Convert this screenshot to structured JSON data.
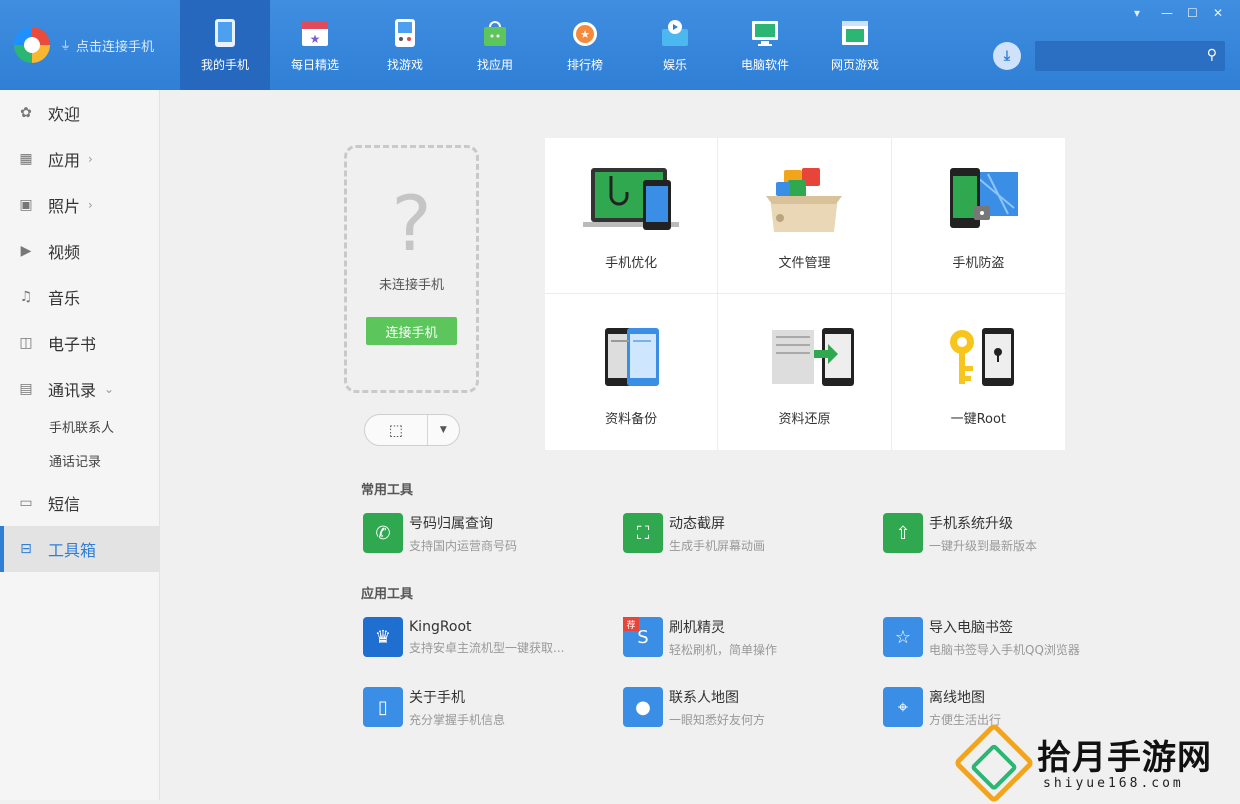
{
  "header": {
    "connect_label": "点击连接手机",
    "tabs": [
      {
        "label": "我的手机",
        "icon": "phone-icon"
      },
      {
        "label": "每日精选",
        "icon": "calendar-star-icon"
      },
      {
        "label": "找游戏",
        "icon": "gamepad-icon"
      },
      {
        "label": "找应用",
        "icon": "android-bag-icon"
      },
      {
        "label": "排行榜",
        "icon": "medal-icon"
      },
      {
        "label": "娱乐",
        "icon": "media-icon"
      },
      {
        "label": "电脑软件",
        "icon": "pc-icon"
      },
      {
        "label": "网页游戏",
        "icon": "web-game-icon"
      }
    ],
    "search_placeholder": ""
  },
  "sidebar": {
    "items": [
      {
        "label": "欢迎"
      },
      {
        "label": "应用"
      },
      {
        "label": "照片"
      },
      {
        "label": "视频"
      },
      {
        "label": "音乐"
      },
      {
        "label": "电子书"
      },
      {
        "label": "通讯录"
      },
      {
        "label": "短信"
      },
      {
        "label": "工具箱"
      }
    ],
    "contacts_sub": [
      "手机联系人",
      "通话记录"
    ]
  },
  "phone": {
    "placeholder_symbol": "?",
    "status": "未连接手机",
    "connect_button": "连接手机"
  },
  "features": [
    {
      "label": "手机优化"
    },
    {
      "label": "文件管理"
    },
    {
      "label": "手机防盗"
    },
    {
      "label": "资料备份"
    },
    {
      "label": "资料还原"
    },
    {
      "label": "一键Root"
    }
  ],
  "common_tools": {
    "title": "常用工具",
    "items": [
      {
        "name": "号码归属查询",
        "desc": "支持国内运营商号码",
        "color": "#2fa84f"
      },
      {
        "name": "动态截屏",
        "desc": "生成手机屏幕动画",
        "color": "#2fa84f"
      },
      {
        "name": "手机系统升级",
        "desc": "一键升级到最新版本",
        "color": "#2fa84f"
      }
    ]
  },
  "app_tools": {
    "title": "应用工具",
    "items": [
      {
        "name": "KingRoot",
        "desc": "支持安卓主流机型一键获取...",
        "color": "#1f6fd1"
      },
      {
        "name": "刷机精灵",
        "desc": "轻松刷机，简单操作",
        "color": "#3a8ee6",
        "badge": "荐"
      },
      {
        "name": "导入电脑书签",
        "desc": "电脑书签导入手机QQ浏览器",
        "color": "#3a8ee6"
      },
      {
        "name": "关于手机",
        "desc": "充分掌握手机信息",
        "color": "#3a8ee6"
      },
      {
        "name": "联系人地图",
        "desc": "一眼知悉好友何方",
        "color": "#3a8ee6"
      },
      {
        "name": "离线地图",
        "desc": "方便生活出行",
        "color": "#3a8ee6"
      }
    ]
  },
  "watermark": {
    "title": "拾月手游网",
    "url": "shiyue168.com"
  },
  "colors": {
    "brand_blue": "#2f7fd6",
    "active_tab": "#2568bd",
    "connect_green": "#5cc65c"
  }
}
